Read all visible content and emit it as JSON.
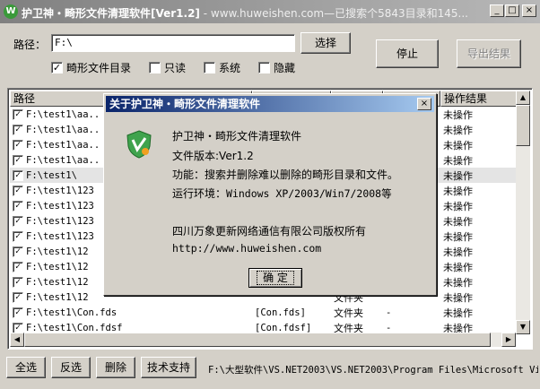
{
  "window": {
    "title": "护卫神・畸形文件清理软件[Ver1.2]",
    "title_suffix": " - www.huweishen.com—已搜索个5843目录和145...",
    "app_icon": "W",
    "controls": [
      "_",
      "□",
      "×"
    ]
  },
  "search": {
    "path_label": "路径：",
    "path_value": "F:\\",
    "browse_label": "选择",
    "stop_label": "停止",
    "export_label": "导出结果",
    "options": [
      {
        "label": "畸形文件目录",
        "checked": true
      },
      {
        "label": "只读",
        "checked": false
      },
      {
        "label": "系统",
        "checked": false
      },
      {
        "label": "隐藏",
        "checked": false
      }
    ]
  },
  "table": {
    "columns": [
      "路径",
      "",
      "",
      "",
      "操作结果"
    ],
    "rows": [
      {
        "path": "F:\\test1\\aa..",
        "name": "",
        "type": "",
        "size": "",
        "status": "未操作",
        "selected": false
      },
      {
        "path": "F:\\test1\\aa..",
        "name": "",
        "type": "",
        "size": "",
        "status": "未操作",
        "selected": false
      },
      {
        "path": "F:\\test1\\aa..",
        "name": "",
        "type": "",
        "size": "",
        "status": "未操作",
        "selected": false
      },
      {
        "path": "F:\\test1\\aa..",
        "name": "",
        "type": "",
        "size": "",
        "status": "未操作",
        "selected": false
      },
      {
        "path": "F:\\test1\\",
        "name": "",
        "type": "",
        "size": "",
        "status": "未操作",
        "selected": true
      },
      {
        "path": "F:\\test1\\123",
        "name": "",
        "type": "",
        "size": "",
        "status": "未操作",
        "selected": false
      },
      {
        "path": "F:\\test1\\123",
        "name": "",
        "type": "",
        "size": "",
        "status": "未操作",
        "selected": false
      },
      {
        "path": "F:\\test1\\123",
        "name": "",
        "type": "",
        "size": "",
        "status": "未操作",
        "selected": false
      },
      {
        "path": "F:\\test1\\123",
        "name": "",
        "type": "",
        "size": "",
        "status": "未操作",
        "selected": false
      },
      {
        "path": "F:\\test1\\12",
        "name": "",
        "type": "",
        "size": "",
        "status": "未操作",
        "selected": false
      },
      {
        "path": "F:\\test1\\12",
        "name": "",
        "type": "",
        "size": "",
        "status": "未操作",
        "selected": false
      },
      {
        "path": "F:\\test1\\12",
        "name": "",
        "type": "",
        "size": "",
        "status": "未操作",
        "selected": false
      },
      {
        "path": "F:\\test1\\12",
        "name": "",
        "type": "文件夹",
        "size": "",
        "status": "未操作",
        "selected": false
      },
      {
        "path": "F:\\test1\\Con.fds",
        "name": "[Con.fds]",
        "type": "文件夹",
        "size": "-",
        "status": "未操作",
        "selected": false
      },
      {
        "path": "F:\\test1\\Con.fdsf",
        "name": "[Con.fdsf]",
        "type": "文件夹",
        "size": "-",
        "status": "未操作",
        "selected": false
      }
    ]
  },
  "buttons": {
    "select_all": "全选",
    "invert": "反选",
    "delete": "删除",
    "support": "技术支持"
  },
  "status_path": "F:\\大型软件\\VS.NET2003\\VS.NET2003\\Program Files\\Microsoft Vi",
  "about": {
    "title": "关于护卫神・畸形文件清理软件",
    "close": "×",
    "product": "护卫神・畸形文件清理软件",
    "version": "文件版本:Ver1.2",
    "function": "功能：搜索并删除难以删除的畸形目录和文件。",
    "env_label": "运行环境：",
    "env_value": "Windows XP/2003/Win7/2008等",
    "company": "四川万象更新网络通信有限公司版权所有",
    "website": "http://www.huweishen.com",
    "ok_label": "确 定"
  }
}
